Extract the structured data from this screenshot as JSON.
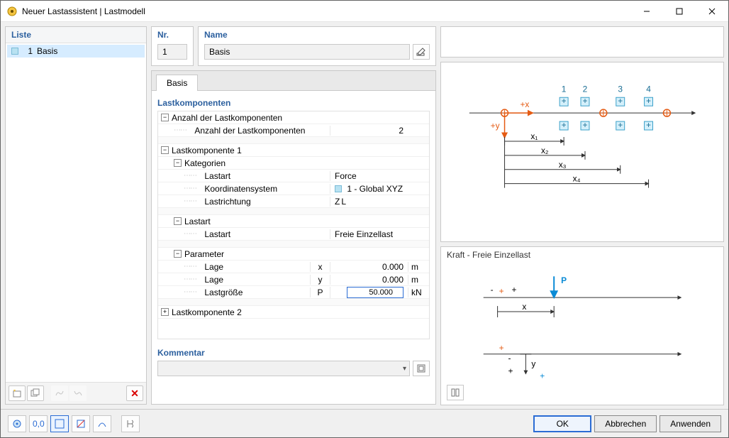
{
  "window": {
    "title": "Neuer Lastassistent | Lastmodell"
  },
  "list": {
    "header": "Liste",
    "items": [
      {
        "num": "1",
        "label": "Basis"
      }
    ],
    "toolbar": {
      "new": "new-item",
      "duplicate": "duplicate",
      "delete": "×"
    }
  },
  "nr": {
    "header": "Nr.",
    "value": "1"
  },
  "name": {
    "header": "Name",
    "value": "Basis"
  },
  "tabs": [
    {
      "label": "Basis",
      "active": true
    }
  ],
  "components": {
    "title": "Lastkomponenten",
    "count_group": "Anzahl der Lastkomponenten",
    "count_label": "Anzahl der Lastkomponenten",
    "count_value": "2",
    "comp1": {
      "title": "Lastkomponente 1",
      "categories": {
        "title": "Kategorien",
        "rows": [
          {
            "label": "Lastart",
            "value": "Force"
          },
          {
            "label": "Koordinatensystem",
            "value": "1 - Global XYZ",
            "swatch": true
          },
          {
            "label": "Lastrichtung",
            "value": "Z",
            "sub": "L"
          }
        ]
      },
      "loadtype": {
        "title": "Lastart",
        "rows": [
          {
            "label": "Lastart",
            "value": "Freie Einzellast"
          }
        ]
      },
      "params": {
        "title": "Parameter",
        "rows": [
          {
            "label": "Lage",
            "sym": "x",
            "value": "0.000",
            "unit": "m"
          },
          {
            "label": "Lage",
            "sym": "y",
            "value": "0.000",
            "unit": "m"
          },
          {
            "label": "Lastgröße",
            "sym": "P",
            "value": "50.000",
            "unit": "kN",
            "editable": true
          }
        ]
      }
    },
    "comp2": {
      "title": "Lastkomponente 2"
    }
  },
  "comment": {
    "title": "Kommentar",
    "value": ""
  },
  "diagram2": {
    "title": "Kraft - Freie Einzellast"
  },
  "buttons": {
    "ok": "OK",
    "cancel": "Abbrechen",
    "apply": "Anwenden"
  },
  "diag1": {
    "nums": [
      "1",
      "2",
      "3",
      "4"
    ],
    "xlabels": [
      "x₁",
      "x₂",
      "x₃",
      "x₄"
    ],
    "axis_x": "+x",
    "axis_y": "+y"
  },
  "diag2": {
    "P": "P",
    "x": "x",
    "y": "y",
    "minus": "-",
    "plus": "+"
  }
}
